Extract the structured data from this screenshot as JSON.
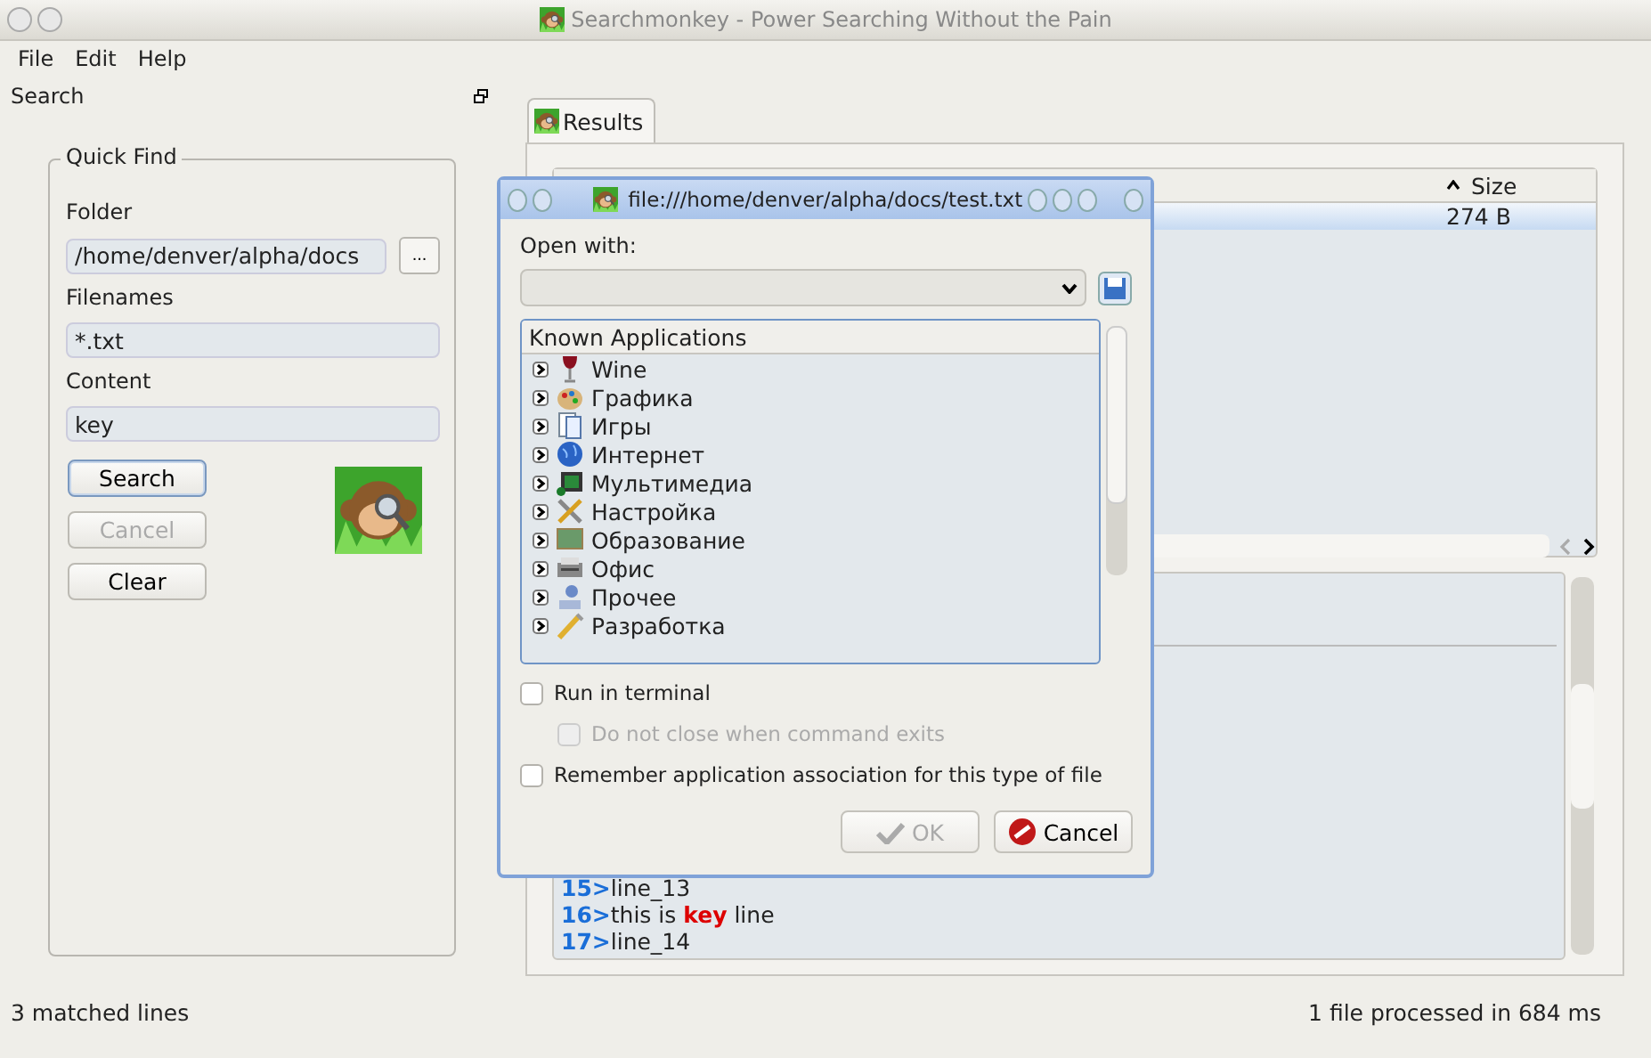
{
  "window": {
    "title": "Searchmonkey - Power Searching Without the Pain"
  },
  "menu": [
    {
      "label": "File"
    },
    {
      "label": "Edit"
    },
    {
      "label": "Help"
    }
  ],
  "dock": {
    "title": "Search",
    "group": {
      "title": "Quick Find",
      "fields": [
        {
          "label": "Folder",
          "value": "/home/denver/alpha/docs",
          "browse": "..."
        },
        {
          "label": "Filenames",
          "value": "*.txt"
        },
        {
          "label": "Content",
          "value": "key"
        }
      ],
      "buttons": [
        {
          "label": "Search",
          "disabled": false,
          "default": true
        },
        {
          "label": "Cancel",
          "disabled": true,
          "default": false
        },
        {
          "label": "Clear",
          "disabled": false,
          "default": false
        }
      ]
    }
  },
  "results": {
    "tabs": [
      {
        "label": "Results",
        "selected": true
      }
    ],
    "table": {
      "columns": [
        {
          "label": "Size",
          "sort_ascending": true
        }
      ],
      "rows": [
        {
          "size": "274  B",
          "selected": true
        }
      ]
    },
    "lines": [
      {
        "number": "15>",
        "parts": [
          {
            "text": "line_13",
            "match": false
          }
        ]
      },
      {
        "number": "16>",
        "parts": [
          {
            "text": "this is ",
            "match": false
          },
          {
            "text": "key",
            "match": true
          },
          {
            "text": " line",
            "match": false
          }
        ]
      },
      {
        "number": "17>",
        "parts": [
          {
            "text": "line_14",
            "match": false
          }
        ]
      }
    ]
  },
  "dialog": {
    "title": "file:///home/denver/alpha/docs/test.txt",
    "open_with_label": "Open with:",
    "tree": {
      "header": "Known Applications",
      "items": [
        {
          "label": "Wine",
          "expanded": false
        },
        {
          "label": "Графика",
          "expanded": false
        },
        {
          "label": "Игры",
          "expanded": false
        },
        {
          "label": "Интернет",
          "expanded": false
        },
        {
          "label": "Мультимедиа",
          "expanded": false
        },
        {
          "label": "Настройка",
          "expanded": false
        },
        {
          "label": "Образование",
          "expanded": false
        },
        {
          "label": "Офис",
          "expanded": false
        },
        {
          "label": "Прочее",
          "expanded": false
        },
        {
          "label": "Разработка",
          "expanded": false
        }
      ]
    },
    "options": [
      {
        "label": "Run in terminal",
        "checked": false,
        "disabled": false,
        "children": [
          {
            "label": "Do not close when command exits",
            "checked": false,
            "disabled": true
          }
        ]
      },
      {
        "label": "Remember application association for this type of file",
        "checked": false,
        "disabled": false
      }
    ],
    "buttons": [
      {
        "label": "OK",
        "kind": "ok",
        "disabled": true
      },
      {
        "label": "Cancel",
        "kind": "cancel",
        "disabled": false
      }
    ]
  },
  "status_bar": {
    "left": "3 matched lines",
    "right": "1 file processed in 684 ms"
  }
}
